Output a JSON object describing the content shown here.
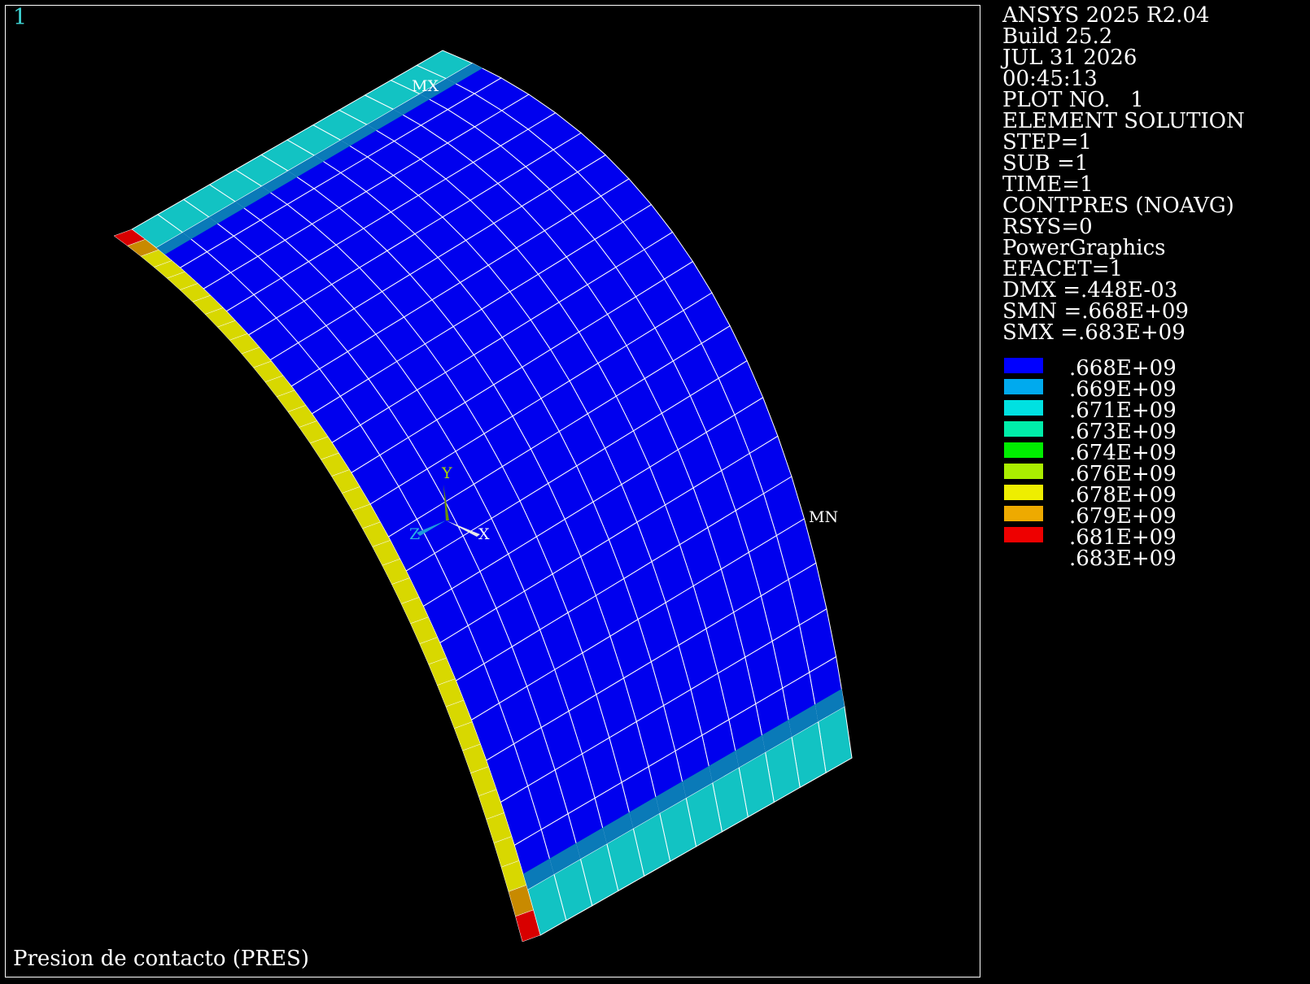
{
  "window_number": "1",
  "plot_title": "Presion de contacto (PRES)",
  "info_lines": [
    "ANSYS 2025 R2.04",
    "Build 25.2",
    "JUL 31 2026",
    "00:45:13",
    "PLOT NO.   1",
    "ELEMENT SOLUTION",
    "STEP=1",
    "SUB =1",
    "TIME=1",
    "CONTPRES (NOAVG)",
    "RSYS=0",
    "PowerGraphics",
    "EFACET=1",
    "DMX =.448E-03",
    "SMN =.668E+09",
    "SMX =.683E+09"
  ],
  "legend": {
    "labels": [
      ".668E+09",
      ".669E+09",
      ".671E+09",
      ".673E+09",
      ".674E+09",
      ".676E+09",
      ".678E+09",
      ".679E+09",
      ".681E+09",
      ".683E+09"
    ],
    "colors": [
      "#0000ff",
      "#00aaee",
      "#00e1e1",
      "#00eeaa",
      "#00ee00",
      "#aaee00",
      "#eeee00",
      "#eeaa00",
      "#ee0000"
    ]
  },
  "markers": {
    "max_label": "MX",
    "min_label": "MN"
  },
  "triad": {
    "x_label": "X",
    "y_label": "Y",
    "z_label": "Z"
  },
  "colors": {
    "background": "#000000",
    "mesh_face": "#0000ee",
    "mesh_lines": "#ffffff",
    "edge_cyan": "#12c3c3",
    "edge_dark_cyan": "#0a7ab8",
    "side_yellow": "#d8d800",
    "side_orange": "#c88a00",
    "side_red": "#d80000"
  }
}
